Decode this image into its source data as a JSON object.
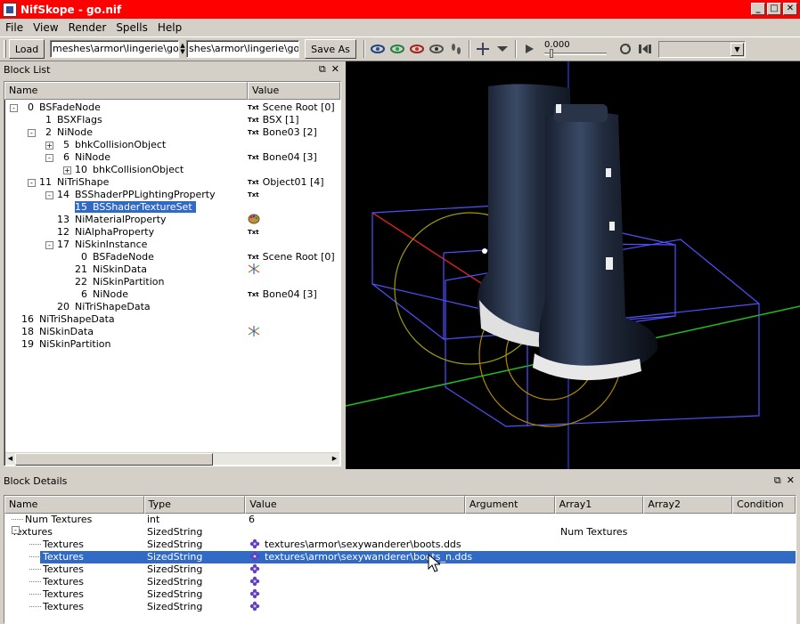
{
  "window": {
    "title": "NifSkope - go.nif"
  },
  "menu": [
    "File",
    "View",
    "Render",
    "Spells",
    "Help"
  ],
  "toolbar": {
    "load_label": "Load",
    "load_path": "meshes\\armor\\lingerie\\go.nif",
    "save_path": "shes\\armor\\lingerie\\go.nif",
    "save_label": "Save As",
    "time_value": "0.000"
  },
  "block_list": {
    "title": "Block List",
    "columns": [
      "Name",
      "Value"
    ],
    "rows": [
      {
        "indent": 0,
        "expander": "-",
        "num": "0",
        "name": "BSFadeNode",
        "txt": true,
        "value": "Scene Root [0]"
      },
      {
        "indent": 1,
        "expander": "",
        "num": "1",
        "name": "BSXFlags",
        "txt": true,
        "value": "BSX [1]"
      },
      {
        "indent": 1,
        "expander": "-",
        "num": "2",
        "name": "NiNode",
        "txt": true,
        "value": "Bone03 [2]"
      },
      {
        "indent": 2,
        "expander": "+",
        "num": "5",
        "name": "bhkCollisionObject",
        "txt": false,
        "value": ""
      },
      {
        "indent": 2,
        "expander": "-",
        "num": "6",
        "name": "NiNode",
        "txt": true,
        "value": "Bone04 [3]"
      },
      {
        "indent": 3,
        "expander": "+",
        "num": "10",
        "name": "bhkCollisionObject",
        "txt": false,
        "value": ""
      },
      {
        "indent": 1,
        "expander": "-",
        "num": "11",
        "name": "NiTriShape",
        "txt": true,
        "value": "Object01 [4]"
      },
      {
        "indent": 2,
        "expander": "-",
        "num": "14",
        "name": "BSShaderPPLightingProperty",
        "txt": true,
        "value": ""
      },
      {
        "indent": 3,
        "expander": "",
        "num": "15",
        "name": "BSShaderTextureSet",
        "txt": false,
        "value": "",
        "selected": true
      },
      {
        "indent": 2,
        "expander": "",
        "num": "13",
        "name": "NiMaterialProperty",
        "txt": false,
        "value": "",
        "icon": "palette"
      },
      {
        "indent": 2,
        "expander": "",
        "num": "12",
        "name": "NiAlphaProperty",
        "txt": true,
        "value": ""
      },
      {
        "indent": 2,
        "expander": "-",
        "num": "17",
        "name": "NiSkinInstance",
        "txt": false,
        "value": ""
      },
      {
        "indent": 3,
        "expander": "",
        "num": "0",
        "name": "BSFadeNode",
        "txt": true,
        "value": "Scene Root [0]"
      },
      {
        "indent": 3,
        "expander": "",
        "num": "21",
        "name": "NiSkinData",
        "txt": false,
        "value": "",
        "icon": "axes"
      },
      {
        "indent": 3,
        "expander": "",
        "num": "22",
        "name": "NiSkinPartition",
        "txt": false,
        "value": ""
      },
      {
        "indent": 3,
        "expander": "",
        "num": "6",
        "name": "NiNode",
        "txt": true,
        "value": "Bone04 [3]"
      },
      {
        "indent": 2,
        "expander": "",
        "num": "20",
        "name": "NiTriShapeData",
        "txt": false,
        "value": ""
      },
      {
        "indent": 0,
        "expander": "",
        "num": "16",
        "name": "NiTriShapeData",
        "txt": false,
        "value": ""
      },
      {
        "indent": 0,
        "expander": "",
        "num": "18",
        "name": "NiSkinData",
        "txt": false,
        "value": "",
        "icon": "axes"
      },
      {
        "indent": 0,
        "expander": "",
        "num": "19",
        "name": "NiSkinPartition",
        "txt": false,
        "value": ""
      }
    ]
  },
  "block_details": {
    "title": "Block Details",
    "columns": [
      "Name",
      "Type",
      "Value",
      "Argument",
      "Array1",
      "Array2",
      "Condition"
    ],
    "rows": [
      {
        "indent": 0,
        "expander": "",
        "name": "Num Textures",
        "type": "int",
        "value": "6",
        "array1": "",
        "icon": false
      },
      {
        "indent": 0,
        "expander": "-",
        "name": "Textures",
        "type": "SizedString",
        "value": "",
        "array1": "Num Textures",
        "icon": false
      },
      {
        "indent": 1,
        "expander": "",
        "name": "Textures",
        "type": "SizedString",
        "value": "textures\\armor\\sexywanderer\\boots.dds",
        "array1": "",
        "icon": true
      },
      {
        "indent": 1,
        "expander": "",
        "name": "Textures",
        "type": "SizedString",
        "value": "textures\\armor\\sexywanderer\\boots_n.dds",
        "array1": "",
        "icon": true,
        "selected": true
      },
      {
        "indent": 1,
        "expander": "",
        "name": "Textures",
        "type": "SizedString",
        "value": "",
        "array1": "",
        "icon": true
      },
      {
        "indent": 1,
        "expander": "",
        "name": "Textures",
        "type": "SizedString",
        "value": "",
        "array1": "",
        "icon": true
      },
      {
        "indent": 1,
        "expander": "",
        "name": "Textures",
        "type": "SizedString",
        "value": "",
        "array1": "",
        "icon": true
      },
      {
        "indent": 1,
        "expander": "",
        "name": "Textures",
        "type": "SizedString",
        "value": "",
        "array1": "",
        "icon": true
      }
    ]
  }
}
